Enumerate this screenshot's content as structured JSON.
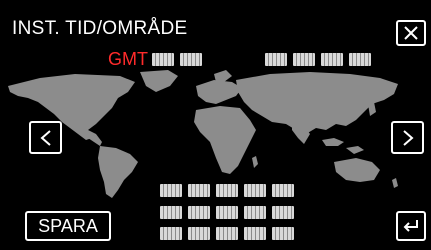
{
  "header": {
    "title": "INST. TID/OMRÅDE"
  },
  "timezone": {
    "gmt_label": "GMT"
  },
  "buttons": {
    "save_label": "SPARA"
  },
  "icons": {
    "close": "close-icon",
    "prev": "chevron-left-icon",
    "next": "chevron-right-icon",
    "return": "return-icon"
  },
  "colors": {
    "gmt": "#ff2b2b",
    "map_land": "#8c8c8c",
    "background": "#000000"
  }
}
